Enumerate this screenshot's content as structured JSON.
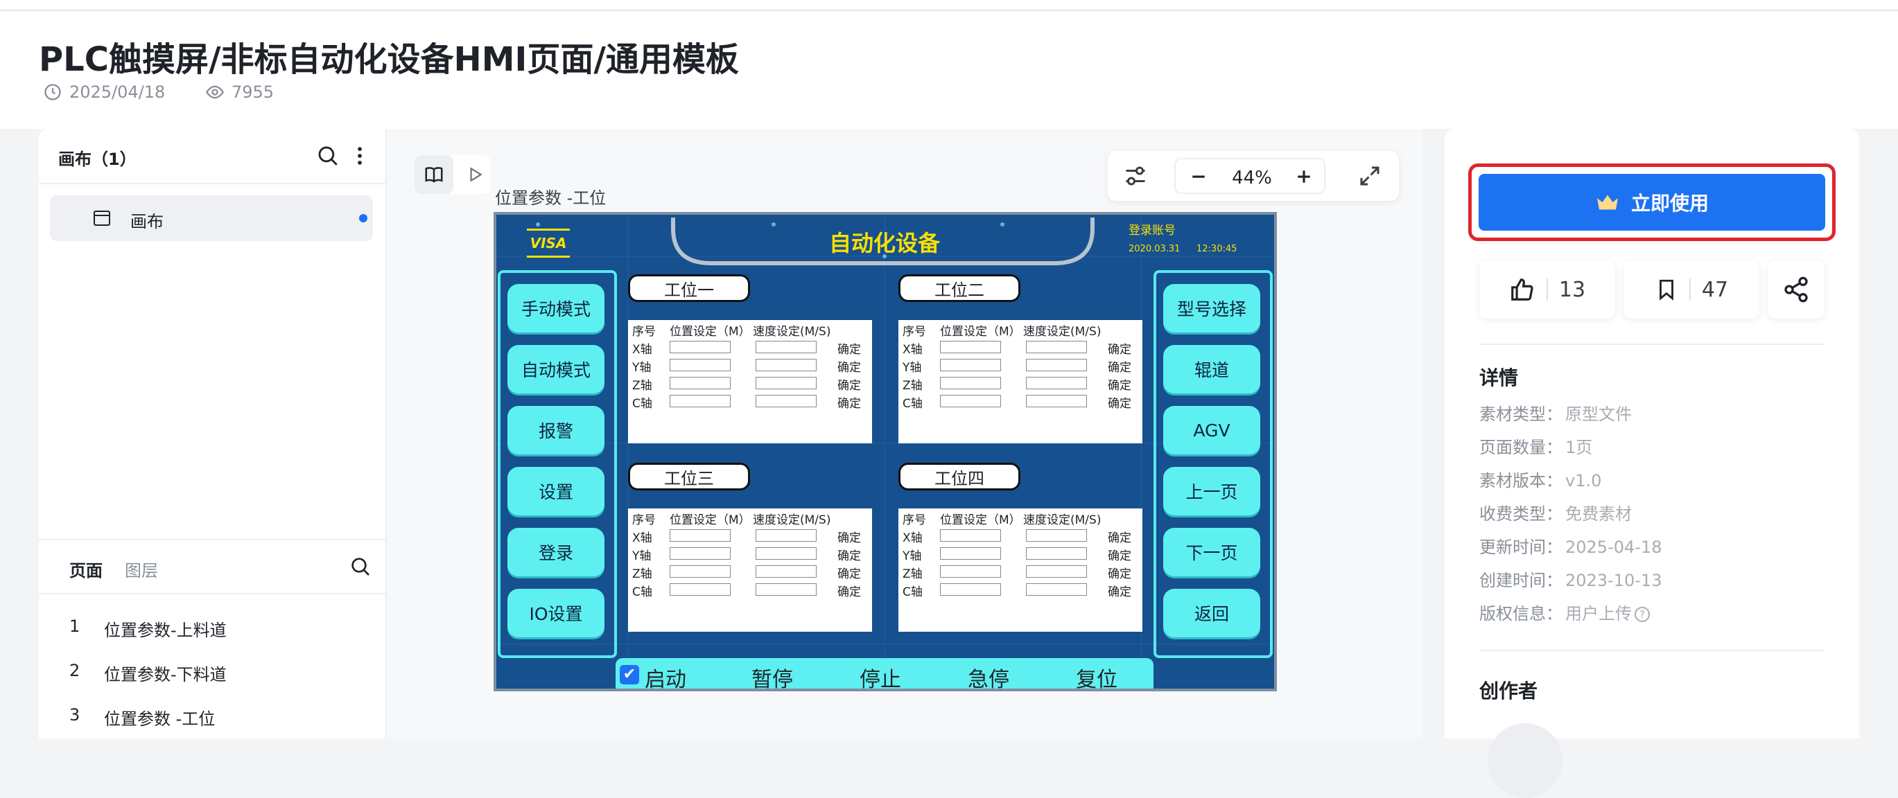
{
  "header": {
    "title": "PLC触摸屏/非标自动化设备HMI页面/通用模板",
    "date": "2025/04/18",
    "views": "7955"
  },
  "left_panel": {
    "title": "画布（1）",
    "canvas_item": "画布",
    "tabs": {
      "pages": "页面",
      "layers": "图层"
    },
    "pages": [
      {
        "num": "1",
        "label": "位置参数-上料道"
      },
      {
        "num": "2",
        "label": "位置参数-下料道"
      },
      {
        "num": "3",
        "label": "位置参数 -工位"
      }
    ]
  },
  "canvas": {
    "page_label": "位置参数 -工位",
    "zoom": "44%"
  },
  "hmi": {
    "logo": "VISA",
    "title": "自动化设备",
    "login": "登录账号",
    "date": "2020.03.31",
    "time": "12:30:45",
    "left_buttons": [
      "手动模式",
      "自动模式",
      "报警",
      "设置",
      "登录",
      "IO设置"
    ],
    "right_buttons": [
      "型号选择",
      "辊道",
      "AGV",
      "上一页",
      "下一页",
      "返回"
    ],
    "stations": [
      "工位一",
      "工位二",
      "工位三",
      "工位四"
    ],
    "table_header": {
      "seq": "序号",
      "pos": "位置设定（M）",
      "speed": "速度设定(M/S)"
    },
    "axes": [
      "X轴",
      "Y轴",
      "Z轴",
      "C轴"
    ],
    "confirm": "确定",
    "bottom_buttons": [
      "启动",
      "暂停",
      "停止",
      "急停",
      "复位"
    ]
  },
  "right_panel": {
    "use_button": "立即使用",
    "likes": "13",
    "favorites": "47",
    "details_title": "详情",
    "details": [
      {
        "k": "素材类型：",
        "v": "原型文件"
      },
      {
        "k": "页面数量：",
        "v": "1页"
      },
      {
        "k": "素材版本：",
        "v": "v1.0"
      },
      {
        "k": "收费类型：",
        "v": "免费素材"
      },
      {
        "k": "更新时间：",
        "v": "2025-04-18"
      },
      {
        "k": "创建时间：",
        "v": "2023-10-13"
      },
      {
        "k": "版权信息：",
        "v": "用户上传"
      }
    ],
    "creator_title": "创作者"
  },
  "colors": {
    "accent": "#1d72f2",
    "highlight": "#e0242b",
    "hmi_bg": "#16508f",
    "hmi_button": "#5ef0f0",
    "hmi_title": "#f7e000"
  }
}
